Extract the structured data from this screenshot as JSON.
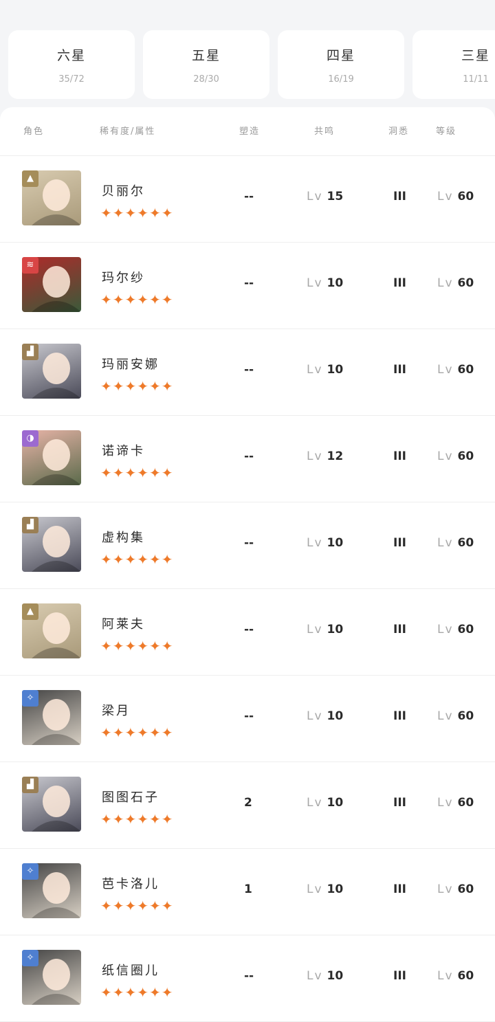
{
  "rarity_tabs": [
    {
      "label": "六星",
      "count": "35/72"
    },
    {
      "label": "五星",
      "count": "28/30"
    },
    {
      "label": "四星",
      "count": "16/19"
    },
    {
      "label": "三星",
      "count": "11/11"
    }
  ],
  "columns": {
    "character": "角色",
    "rarity_attr": "稀有度/属性",
    "reshape": "塑造",
    "resonance": "共鸣",
    "insight": "洞悉",
    "level": "等级"
  },
  "level_prefix": "Lv",
  "stars": "✦✦✦✦✦✦",
  "colors": {
    "star": "#ee7a2a",
    "attr_earth": "#a58d5a",
    "attr_fire": "#d84545",
    "attr_mineral": "#9a7f55",
    "attr_spirit": "#9c6ad0",
    "attr_star": "#4f7fd0"
  },
  "characters": [
    {
      "name": "贝丽尔",
      "attribute": "earth",
      "attr_icon": "triangle-icon",
      "reshape": "--",
      "resonance": "15",
      "insight": "III",
      "level": "60"
    },
    {
      "name": "玛尔纱",
      "attribute": "fire",
      "attr_icon": "claw-icon",
      "reshape": "--",
      "resonance": "10",
      "insight": "III",
      "level": "60"
    },
    {
      "name": "玛丽安娜",
      "attribute": "mineral",
      "attr_icon": "building-icon",
      "reshape": "--",
      "resonance": "10",
      "insight": "III",
      "level": "60"
    },
    {
      "name": "诺谛卡",
      "attribute": "spirit",
      "attr_icon": "moon-icon",
      "reshape": "--",
      "resonance": "12",
      "insight": "III",
      "level": "60"
    },
    {
      "name": "虚构集",
      "attribute": "mineral",
      "attr_icon": "building-icon",
      "reshape": "--",
      "resonance": "10",
      "insight": "III",
      "level": "60"
    },
    {
      "name": "阿莱夫",
      "attribute": "earth",
      "attr_icon": "triangle-icon",
      "reshape": "--",
      "resonance": "10",
      "insight": "III",
      "level": "60"
    },
    {
      "name": "梁月",
      "attribute": "star",
      "attr_icon": "sparkle-icon",
      "reshape": "--",
      "resonance": "10",
      "insight": "III",
      "level": "60"
    },
    {
      "name": "图图石子",
      "attribute": "mineral",
      "attr_icon": "building-icon",
      "reshape": "2",
      "resonance": "10",
      "insight": "III",
      "level": "60"
    },
    {
      "name": "芭卡洛儿",
      "attribute": "star",
      "attr_icon": "sparkle-icon",
      "reshape": "1",
      "resonance": "10",
      "insight": "III",
      "level": "60"
    },
    {
      "name": "纸信圈儿",
      "attribute": "star",
      "attr_icon": "sparkle-icon",
      "reshape": "--",
      "resonance": "10",
      "insight": "III",
      "level": "60"
    }
  ]
}
